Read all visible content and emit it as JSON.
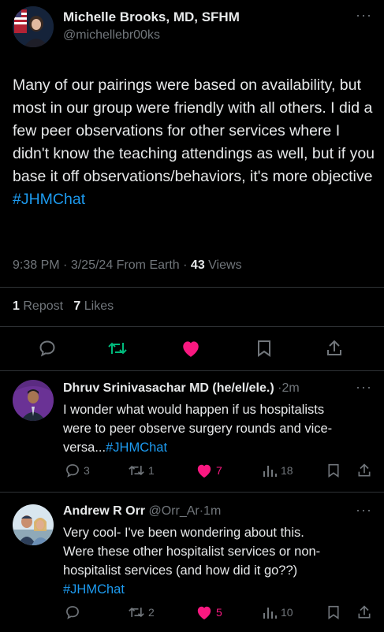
{
  "main_tweet": {
    "author_name": "Michelle Brooks, MD, SFHM",
    "handle": "@michellebr00ks",
    "text": "Many of our pairings were based on availability, but most in our group were friendly with all others. I did a few peer observations for other services where I didn't know the teaching attendings as well, but if you base it off observations/behaviors, it's more objective",
    "hashtag": "#JHMChat",
    "time": "9:38 PM",
    "date": "3/25/24",
    "source": "From Earth",
    "views_count": "43",
    "views_label": "Views",
    "reposts_count": "1",
    "reposts_label": "Repost",
    "likes_count": "7",
    "likes_label": "Likes",
    "liked": true
  },
  "replies": [
    {
      "author_name": "Dhruv Srinivasachar MD (he/el/ele.)",
      "time": "2m",
      "line1": "I wonder what would happen if us hospitalists",
      "line2": "were to peer observe surgery rounds and vice-",
      "line3": "versa...",
      "hashtag": "#JHMChat",
      "replies": "3",
      "reposts": "1",
      "likes": "7",
      "views": "18"
    },
    {
      "author_name": "Andrew R Orr",
      "handle": "@Orr_Ar",
      "time": "1m",
      "line1": "Very cool- I've been wondering about this.",
      "line2": "Were these other hospitalist services or non-",
      "line3": "hospitalist services (and how did it go??)",
      "hashtag": "#JHMChat",
      "replies": "",
      "reposts": "2",
      "likes": "5",
      "views": "10"
    }
  ],
  "colors": {
    "background": "#000000",
    "text": "#e7e9ea",
    "muted": "#71767b",
    "link": "#1d9bf0",
    "like": "#f91880",
    "repost": "#00ba7c"
  },
  "separator": "·",
  "more_glyph": "···"
}
